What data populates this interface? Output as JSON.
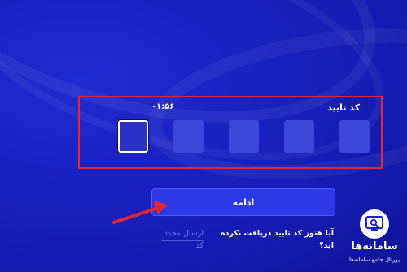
{
  "verify": {
    "code_label": "کد تایید",
    "timer": "۰۱:۵۶",
    "otp_digits": [
      "",
      "",
      "",
      "",
      ""
    ]
  },
  "actions": {
    "continue_label": "ادامه",
    "not_received_text": "آیا هنوز کد تایید دریافت نکرده اید؟",
    "resend_label": "ارسال مجدد کد"
  },
  "brand": {
    "name": "سامانه‌ها",
    "tagline": "پورتال جامع سامانه‌ها",
    "icon": "monitor-search-icon"
  },
  "colors": {
    "background": "#1a22c4",
    "highlight_frame": "#e3262f",
    "otp_box": "#3a47d8",
    "button": "#2d39e6",
    "link": "#6b78ff",
    "annotation_arrow": "#e3262f"
  }
}
